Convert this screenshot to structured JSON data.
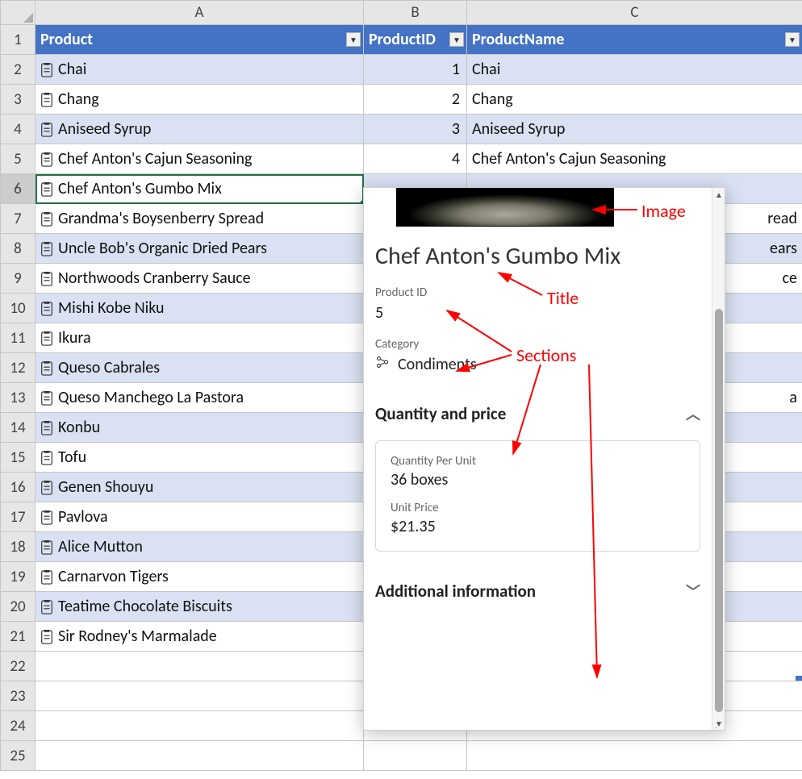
{
  "columns": {
    "A": "A",
    "B": "B",
    "C": "C"
  },
  "headers": {
    "product": "Product",
    "productId": "ProductID",
    "productName": "ProductName"
  },
  "rows": [
    {
      "r": 2,
      "product": "Chai",
      "id": "1",
      "name": "Chai"
    },
    {
      "r": 3,
      "product": "Chang",
      "id": "2",
      "name": "Chang"
    },
    {
      "r": 4,
      "product": "Aniseed Syrup",
      "id": "3",
      "name": "Aniseed Syrup"
    },
    {
      "r": 5,
      "product": "Chef Anton's Cajun Seasoning",
      "id": "4",
      "name": "Chef Anton's Cajun Seasoning"
    },
    {
      "r": 6,
      "product": "Chef Anton's Gumbo Mix",
      "id": "",
      "name": ""
    },
    {
      "r": 7,
      "product": "Grandma's Boysenberry Spread",
      "id": "",
      "name_suffix": "read"
    },
    {
      "r": 8,
      "product": "Uncle Bob's Organic Dried Pears",
      "id": "",
      "name_suffix": "ears"
    },
    {
      "r": 9,
      "product": "Northwoods Cranberry Sauce",
      "id": "",
      "name_suffix": "ce"
    },
    {
      "r": 10,
      "product": "Mishi Kobe Niku",
      "id": "",
      "name_suffix": ""
    },
    {
      "r": 11,
      "product": "Ikura",
      "id": "",
      "name_suffix": ""
    },
    {
      "r": 12,
      "product": "Queso Cabrales",
      "id": "",
      "name_suffix": ""
    },
    {
      "r": 13,
      "product": "Queso Manchego La Pastora",
      "id": "",
      "name_suffix": "a"
    },
    {
      "r": 14,
      "product": "Konbu",
      "id": "",
      "name_suffix": ""
    },
    {
      "r": 15,
      "product": "Tofu",
      "id": "",
      "name_suffix": ""
    },
    {
      "r": 16,
      "product": "Genen Shouyu",
      "id": "",
      "name_suffix": ""
    },
    {
      "r": 17,
      "product": "Pavlova",
      "id": "",
      "name_suffix": ""
    },
    {
      "r": 18,
      "product": "Alice Mutton",
      "id": "",
      "name_suffix": ""
    },
    {
      "r": 19,
      "product": "Carnarvon Tigers",
      "id": "",
      "name_suffix": ""
    },
    {
      "r": 20,
      "product": "Teatime Chocolate Biscuits",
      "id": "",
      "name_suffix": ""
    },
    {
      "r": 21,
      "product": "Sir Rodney's Marmalade",
      "id": "",
      "name_suffix": ""
    }
  ],
  "selected_row": 6,
  "card": {
    "title": "Chef Anton's Gumbo Mix",
    "productId_label": "Product ID",
    "productId_value": "5",
    "category_label": "Category",
    "category_value": "Condiments",
    "qp_header": "Quantity and price",
    "qpu_label": "Quantity Per Unit",
    "qpu_value": "36 boxes",
    "unitprice_label": "Unit Price",
    "unitprice_value": "$21.35",
    "addl_header": "Additional information"
  },
  "annotations": {
    "image": "Image",
    "title": "Title",
    "sections": "Sections"
  }
}
